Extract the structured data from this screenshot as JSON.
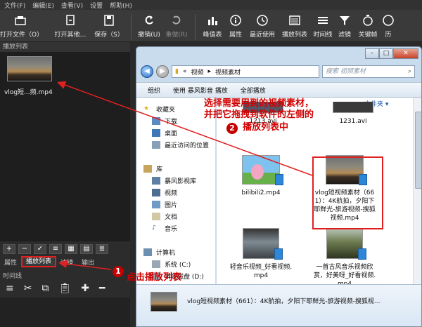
{
  "menu": [
    "文件(F)",
    "编辑(E)",
    "查看(V)",
    "设置",
    "帮助(H)"
  ],
  "toolbar": {
    "open_file": "打开文件（O）",
    "open_other": "打开其他…",
    "save": "保存（S）",
    "undo": "撤销(U)",
    "redo": "重做(R)",
    "peak": "峰值表",
    "properties": "属性",
    "recent": "最近使用",
    "playlist": "播放列表",
    "timeline": "时间线",
    "filter": "滤镜",
    "keyframe": "关键帧",
    "more": "历"
  },
  "left_panel": {
    "title": "播放列表",
    "item_label": "vlog短...频.mp4",
    "tabs": [
      "属性",
      "播放列表",
      "滤镜",
      "输出"
    ],
    "timeline_title": "时间线"
  },
  "explorer": {
    "address": [
      "视频",
      "视频素材"
    ],
    "search_placeholder": "搜索 视频素材",
    "commands": [
      "组织",
      "使用 暴风影音 播放",
      "全部播放"
    ],
    "sort_label": "文件夹",
    "nav": {
      "favorites": "收藏夹",
      "downloads": "下载",
      "desktop": "桌面",
      "recent": "最近访问的位置",
      "library": "库",
      "baofeng": "暴风影视库",
      "video": "视频",
      "pictures": "图片",
      "documents": "文档",
      "music": "音乐",
      "computer": "计算机",
      "system_c": "系统 (C:)",
      "local_d": "本地磁盘 (D:)"
    },
    "files": [
      {
        "name": "1213.avi"
      },
      {
        "name": "1231.avi"
      },
      {
        "name": "bilibili2.mp4"
      },
      {
        "name": "vlog短视频素材（661）：4K航拍，夕阳下耶鲜光-旅游视频-搜狐视频.mp4"
      },
      {
        "name": "轻音乐视频_好看视频.mp4"
      },
      {
        "name": "一首古风音乐视频欣赏，好美呀_好看视频.mp4"
      }
    ],
    "details_text": "vlog短视频素材（661）：4K航拍，夕阳下耶鲜光-旅游视频-搜狐视..."
  },
  "annotations": {
    "step1_num": "1",
    "step1_text": "点击播放列表",
    "step2_num": "2",
    "step2_line1": "选择需要用到的视频素材，",
    "step2_line2": "并把它拖拽到软件的左侧的",
    "step2_line3": "播放列表中"
  }
}
